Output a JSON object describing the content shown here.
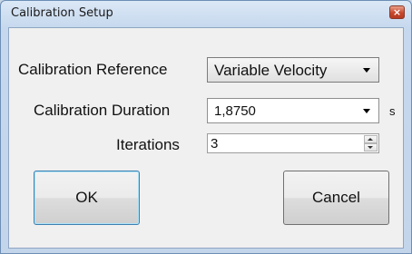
{
  "window": {
    "title": "Calibration Setup",
    "close_glyph": "×"
  },
  "form": {
    "reference_label": "Calibration Reference",
    "reference_value": "Variable Velocity",
    "duration_label": "Calibration Duration",
    "duration_value": "1,8750",
    "duration_unit": "s",
    "iterations_label": "Iterations",
    "iterations_value": "3"
  },
  "buttons": {
    "ok_label": "OK",
    "cancel_label": "Cancel"
  },
  "colors": {
    "default_button_border": "#3c7fb1",
    "close_button": "#c7472b"
  }
}
